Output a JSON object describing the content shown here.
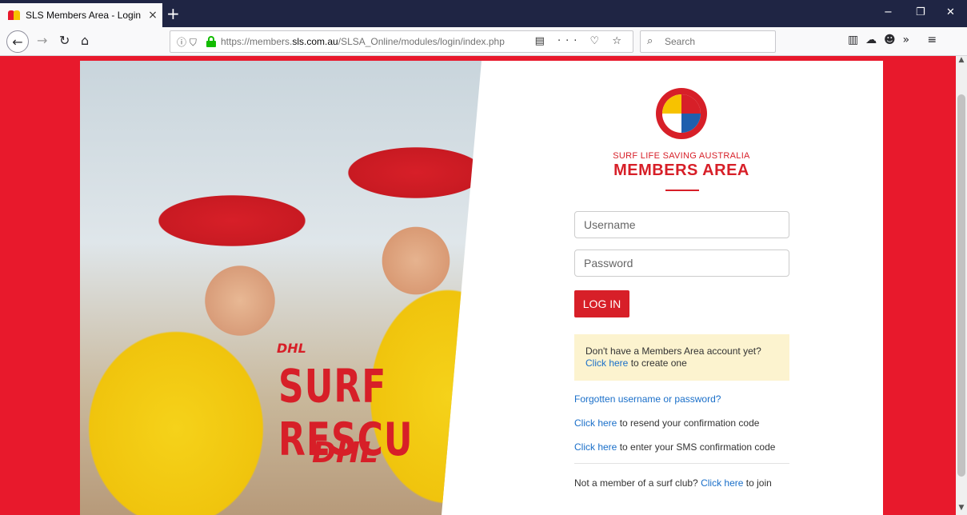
{
  "browser": {
    "tab_title": "SLS Members Area - Login",
    "tab_close": "×",
    "new_tab": "+",
    "url_prefix": "https://members.",
    "url_domain": "sls.com.au",
    "url_path": "/SLSA_Online/modules/login/index.php",
    "search_placeholder": "Search",
    "min": "−",
    "restore": "❐",
    "close": "✕"
  },
  "login": {
    "org_name": "SURF LIFE SAVING AUSTRALIA",
    "area_title": "MEMBERS AREA",
    "username_placeholder": "Username",
    "password_placeholder": "Password",
    "login_button": "LOG IN"
  },
  "notice": {
    "text": "Don't have a Members Area account yet?",
    "link": "Click here",
    "suffix": " to create one"
  },
  "links": {
    "forgot": "Forgotten username or password?",
    "resend_link": "Click here",
    "resend_text": " to resend your confirmation code",
    "sms_link": "Click here",
    "sms_text": " to enter your SMS confirmation code",
    "join_prefix": "Not a member of a surf club? ",
    "join_link": "Click here",
    "join_suffix": " to join"
  },
  "photo": {
    "shirt_text": "SURF RESCU",
    "sponsor": "DHL",
    "sponsor_small": "DHL"
  },
  "colors": {
    "brand_red": "#d71f28",
    "page_red": "#e8192c",
    "notice_bg": "#fcf3cf",
    "link_blue": "#1a6fc9"
  }
}
